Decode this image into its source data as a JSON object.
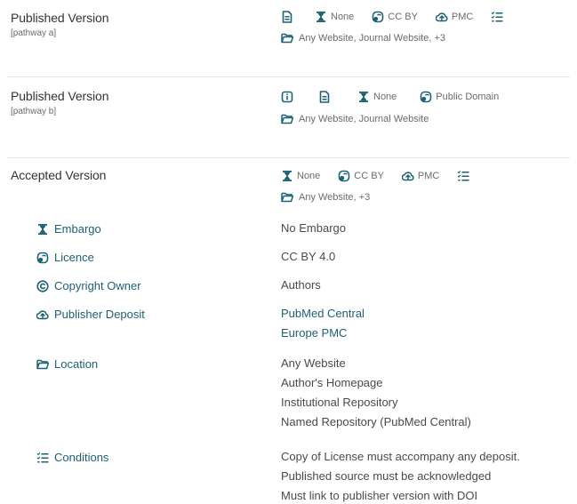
{
  "pathway_a": {
    "title": "Published Version",
    "subtitle": "[pathway a]",
    "embargo": "None",
    "licence": "CC BY",
    "deposit": "PMC",
    "location": "Any Website, Journal Website, +3"
  },
  "pathway_b": {
    "title": "Published Version",
    "subtitle": "[pathway b]",
    "embargo": "None",
    "licence": "Public Domain",
    "location": "Any Website, Journal Website"
  },
  "accepted": {
    "title": "Accepted Version",
    "embargo": "None",
    "licence": "CC BY",
    "deposit": "PMC",
    "location": "Any Website, +3"
  },
  "details": {
    "embargo_label": "Embargo",
    "embargo_value": "No Embargo",
    "licence_label": "Licence",
    "licence_value": "CC BY 4.0",
    "copyright_label": "Copyright Owner",
    "copyright_value": "Authors",
    "deposit_label": "Publisher Deposit",
    "deposit_values": [
      "PubMed Central",
      "Europe PMC"
    ],
    "location_label": "Location",
    "location_values": [
      "Any Website",
      "Author's Homepage",
      "Institutional Repository",
      "Named Repository (PubMed Central)"
    ],
    "conditions_label": "Conditions",
    "conditions_values": [
      "Copy of License must accompany any deposit.",
      "Published source must be acknowledged",
      "Must link to publisher version with DOI"
    ]
  },
  "colors": {
    "icon": "#1d6272",
    "link": "#1f5f72",
    "muted": "#6b6b6b",
    "separator": "#e6e6e6"
  }
}
